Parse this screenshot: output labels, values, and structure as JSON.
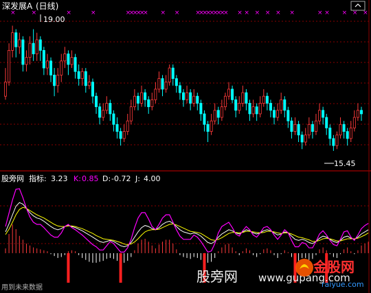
{
  "header": {
    "stock_title": "深发展A",
    "period": "(日线)"
  },
  "indicator_header": {
    "site": "股旁网",
    "label": "指标:",
    "value": "3.23",
    "k_label": "K:",
    "k_value": "0.85",
    "d_label": "D:",
    "d_value": "-0.72",
    "j_label": "J:",
    "j_value": "4.00"
  },
  "watermarks": {
    "site_cn": "股旁网",
    "site_url": "www.gupang.com",
    "bottom_note": "用到未来数据",
    "logo_text": "金股网",
    "logo_url": "raiyue.com"
  },
  "colors": {
    "background": "#000000",
    "up_candle": "#ff3b3b",
    "down_candle": "#00ffff",
    "grid": "#8b0000",
    "kdj_k": "#ffffff",
    "kdj_d": "#ffff00",
    "kdj_j": "#ff00ff",
    "signal": "#ff00ff",
    "title": "#ffffff"
  },
  "chart_data": [
    {
      "type": "candlestick",
      "title": "深发展A (日线)",
      "ylim": [
        15.0,
        19.3
      ],
      "annotations": [
        {
          "text": "19.00",
          "kind": "high"
        },
        {
          "text": "15.45",
          "kind": "low"
        }
      ],
      "signals": [
        2,
        8,
        18,
        25,
        35,
        36,
        37,
        38,
        39,
        40,
        45,
        49,
        55,
        56,
        57,
        58,
        59,
        60,
        61,
        62,
        63,
        67,
        69,
        72,
        75,
        78,
        82,
        90,
        92,
        97,
        100,
        103
      ],
      "candles": [
        [
          17.0,
          17.4,
          17.8,
          16.9
        ],
        [
          17.4,
          18.3,
          18.5,
          17.3
        ],
        [
          18.3,
          18.8,
          19.0,
          18.1
        ],
        [
          18.8,
          18.4,
          18.9,
          18.1
        ],
        [
          18.4,
          18.6,
          18.8,
          18.2
        ],
        [
          18.6,
          17.9,
          18.7,
          17.7
        ],
        [
          17.9,
          18.1,
          18.3,
          17.7
        ],
        [
          18.1,
          18.5,
          18.7,
          17.9
        ],
        [
          18.5,
          18.2,
          18.9,
          18.0
        ],
        [
          18.2,
          18.6,
          18.8,
          18.0
        ],
        [
          18.6,
          18.3,
          18.7,
          18.0
        ],
        [
          18.3,
          17.8,
          18.4,
          17.6
        ],
        [
          17.8,
          18.0,
          18.2,
          17.6
        ],
        [
          18.0,
          17.6,
          18.1,
          17.4
        ],
        [
          17.6,
          17.3,
          17.8,
          17.0
        ],
        [
          17.3,
          17.6,
          17.8,
          17.1
        ],
        [
          17.6,
          18.0,
          18.2,
          17.4
        ],
        [
          18.0,
          18.2,
          18.4,
          17.8
        ],
        [
          18.2,
          17.9,
          18.3,
          17.6
        ],
        [
          17.9,
          18.1,
          18.3,
          17.8
        ],
        [
          18.1,
          17.7,
          18.2,
          17.5
        ],
        [
          17.7,
          17.5,
          17.9,
          17.3
        ],
        [
          17.5,
          17.7,
          17.8,
          17.3
        ],
        [
          17.7,
          17.3,
          17.8,
          17.1
        ],
        [
          17.3,
          17.4,
          17.6,
          17.2
        ],
        [
          17.4,
          17.0,
          17.5,
          16.8
        ],
        [
          17.0,
          16.7,
          17.1,
          16.5
        ],
        [
          16.7,
          16.4,
          16.8,
          16.2
        ],
        [
          16.4,
          16.6,
          16.8,
          16.3
        ],
        [
          16.6,
          16.8,
          17.0,
          16.5
        ],
        [
          16.8,
          16.5,
          16.9,
          16.3
        ],
        [
          16.5,
          16.2,
          16.6,
          16.0
        ],
        [
          16.2,
          16.0,
          16.4,
          15.8
        ],
        [
          16.0,
          15.8,
          16.1,
          15.6
        ],
        [
          15.8,
          16.0,
          16.2,
          15.7
        ],
        [
          16.0,
          16.3,
          16.5,
          15.9
        ],
        [
          16.3,
          16.7,
          16.9,
          16.2
        ],
        [
          16.7,
          17.0,
          17.2,
          16.6
        ],
        [
          17.0,
          16.8,
          17.1,
          16.6
        ],
        [
          16.8,
          17.1,
          17.3,
          16.7
        ],
        [
          17.1,
          16.9,
          17.2,
          16.7
        ],
        [
          16.9,
          16.7,
          17.0,
          16.5
        ],
        [
          16.7,
          16.9,
          17.1,
          16.6
        ],
        [
          16.9,
          17.2,
          17.4,
          16.8
        ],
        [
          17.2,
          17.5,
          17.7,
          17.1
        ],
        [
          17.5,
          17.2,
          17.6,
          17.0
        ],
        [
          17.2,
          17.4,
          17.6,
          17.1
        ],
        [
          17.4,
          17.8,
          17.9,
          17.3
        ],
        [
          17.8,
          17.5,
          17.9,
          17.3
        ],
        [
          17.5,
          17.3,
          17.6,
          17.1
        ],
        [
          17.3,
          17.1,
          17.4,
          16.9
        ],
        [
          17.1,
          16.9,
          17.2,
          16.7
        ],
        [
          16.9,
          17.1,
          17.3,
          16.8
        ],
        [
          17.1,
          16.8,
          17.2,
          16.6
        ],
        [
          16.8,
          17.0,
          17.2,
          16.7
        ],
        [
          17.0,
          16.8,
          17.1,
          16.6
        ],
        [
          16.8,
          16.5,
          16.9,
          16.3
        ],
        [
          16.5,
          16.2,
          16.6,
          16.0
        ],
        [
          16.2,
          16.0,
          16.3,
          15.7
        ],
        [
          16.0,
          16.3,
          16.5,
          15.9
        ],
        [
          16.3,
          16.6,
          16.8,
          16.2
        ],
        [
          16.6,
          16.4,
          16.7,
          16.2
        ],
        [
          16.4,
          16.7,
          16.9,
          16.3
        ],
        [
          16.7,
          17.0,
          17.1,
          16.6
        ],
        [
          17.0,
          17.2,
          17.4,
          16.9
        ],
        [
          17.2,
          16.9,
          17.3,
          16.8
        ],
        [
          16.9,
          16.6,
          17.0,
          16.4
        ],
        [
          16.6,
          16.8,
          17.0,
          16.5
        ],
        [
          16.8,
          17.1,
          17.3,
          16.7
        ],
        [
          17.1,
          16.8,
          17.2,
          16.6
        ],
        [
          16.8,
          16.5,
          16.9,
          16.3
        ],
        [
          16.5,
          16.7,
          16.9,
          16.4
        ],
        [
          16.7,
          16.5,
          16.8,
          16.3
        ],
        [
          16.5,
          16.8,
          17.0,
          16.4
        ],
        [
          16.8,
          17.0,
          17.2,
          16.7
        ],
        [
          17.0,
          16.8,
          17.1,
          16.6
        ],
        [
          16.8,
          16.6,
          16.9,
          16.4
        ],
        [
          16.6,
          16.4,
          16.7,
          16.2
        ],
        [
          16.4,
          16.6,
          16.8,
          16.3
        ],
        [
          16.6,
          16.9,
          17.1,
          16.5
        ],
        [
          16.9,
          16.6,
          17.0,
          16.4
        ],
        [
          16.6,
          16.3,
          16.7,
          16.1
        ],
        [
          16.3,
          16.0,
          16.4,
          15.8
        ],
        [
          16.0,
          16.2,
          16.4,
          15.9
        ],
        [
          16.2,
          15.9,
          16.3,
          15.7
        ],
        [
          15.9,
          15.7,
          16.0,
          15.5
        ],
        [
          15.7,
          15.9,
          16.1,
          15.6
        ],
        [
          15.9,
          16.2,
          16.4,
          15.8
        ],
        [
          16.2,
          16.0,
          16.3,
          15.8
        ],
        [
          16.0,
          16.3,
          16.5,
          15.9
        ],
        [
          16.3,
          16.6,
          16.8,
          16.2
        ],
        [
          16.6,
          16.4,
          16.7,
          16.2
        ],
        [
          16.4,
          16.1,
          16.5,
          15.9
        ],
        [
          16.1,
          15.8,
          16.2,
          15.6
        ],
        [
          15.8,
          15.6,
          15.9,
          15.45
        ],
        [
          15.6,
          15.9,
          16.0,
          15.5
        ],
        [
          15.9,
          16.2,
          16.4,
          15.8
        ],
        [
          16.2,
          16.0,
          16.3,
          15.8
        ],
        [
          16.0,
          15.8,
          16.1,
          15.6
        ],
        [
          15.8,
          16.1,
          16.3,
          15.7
        ],
        [
          16.1,
          16.4,
          16.6,
          16.0
        ],
        [
          16.4,
          16.6,
          16.8,
          16.3
        ],
        [
          16.6,
          16.5,
          16.7,
          16.3
        ]
      ]
    },
    {
      "type": "line",
      "title": "",
      "ylim": [
        -40,
        130
      ],
      "series": [
        {
          "name": "K",
          "values": [
            40,
            55,
            72,
            88,
            95,
            92,
            84,
            76,
            70,
            66,
            64,
            60,
            55,
            50,
            46,
            44,
            46,
            50,
            52,
            50,
            48,
            45,
            42,
            38,
            34,
            30,
            26,
            22,
            20,
            22,
            24,
            22,
            18,
            14,
            12,
            14,
            20,
            30,
            40,
            48,
            52,
            50,
            46,
            44,
            48,
            54,
            58,
            60,
            56,
            50,
            44,
            40,
            38,
            36,
            38,
            36,
            32,
            26,
            20,
            18,
            22,
            30,
            36,
            40,
            44,
            42,
            38,
            36,
            40,
            44,
            42,
            38,
            36,
            38,
            42,
            44,
            42,
            38,
            34,
            36,
            40,
            38,
            32,
            26,
            24,
            26,
            24,
            20,
            18,
            22,
            28,
            32,
            30,
            26,
            22,
            20,
            24,
            30,
            32,
            28,
            26,
            30,
            36,
            40,
            44
          ]
        },
        {
          "name": "D",
          "values": [
            35,
            45,
            58,
            72,
            82,
            86,
            84,
            80,
            76,
            72,
            69,
            66,
            62,
            58,
            54,
            51,
            50,
            50,
            51,
            51,
            50,
            48,
            46,
            43,
            40,
            37,
            33,
            30,
            27,
            26,
            25,
            24,
            22,
            20,
            17,
            16,
            17,
            21,
            27,
            34,
            40,
            43,
            44,
            44,
            45,
            48,
            51,
            54,
            55,
            53,
            50,
            47,
            44,
            41,
            40,
            39,
            37,
            33,
            29,
            25,
            24,
            26,
            29,
            33,
            37,
            39,
            39,
            38,
            39,
            41,
            41,
            40,
            39,
            38,
            39,
            41,
            41,
            40,
            38,
            37,
            38,
            38,
            36,
            33,
            30,
            29,
            27,
            25,
            22,
            22,
            24,
            27,
            28,
            27,
            25,
            23,
            23,
            25,
            27,
            27,
            27,
            28,
            31,
            34,
            38
          ]
        },
        {
          "name": "J",
          "values": [
            50,
            75,
            100,
            120,
            121,
            104,
            84,
            68,
            58,
            54,
            54,
            48,
            41,
            34,
            30,
            30,
            38,
            50,
            54,
            48,
            44,
            39,
            34,
            28,
            22,
            16,
            12,
            6,
            6,
            14,
            22,
            18,
            10,
            2,
            2,
            10,
            26,
            48,
            66,
            76,
            76,
            64,
            50,
            44,
            54,
            66,
            72,
            72,
            58,
            44,
            32,
            26,
            26,
            26,
            34,
            30,
            22,
            12,
            2,
            4,
            18,
            38,
            50,
            54,
            58,
            48,
            36,
            32,
            42,
            50,
            44,
            34,
            30,
            38,
            48,
            50,
            44,
            34,
            26,
            34,
            44,
            38,
            24,
            12,
            12,
            20,
            18,
            10,
            10,
            22,
            36,
            42,
            34,
            24,
            16,
            14,
            26,
            40,
            42,
            30,
            24,
            34,
            46,
            52,
            56
          ]
        }
      ],
      "histogram": [
        5,
        20,
        30,
        25,
        18,
        14,
        10,
        8,
        6,
        5,
        4,
        3,
        2,
        -1,
        -3,
        -5,
        -4,
        -2,
        2,
        3,
        2,
        -2,
        -5,
        -7,
        -9,
        -10,
        -10,
        -9,
        -8,
        -6,
        -5,
        -6,
        -8,
        -9,
        -10,
        -8,
        -4,
        3,
        10,
        14,
        15,
        12,
        8,
        5,
        9,
        12,
        14,
        14,
        10,
        4,
        -2,
        -4,
        -5,
        -6,
        -4,
        -5,
        -7,
        -9,
        -10,
        -9,
        -5,
        2,
        6,
        9,
        10,
        6,
        2,
        -2,
        2,
        5,
        3,
        -2,
        -4,
        -1,
        4,
        5,
        3,
        -2,
        -5,
        -1,
        3,
        1,
        -4,
        -8,
        -8,
        -5,
        -5,
        -7,
        -6,
        -2,
        4,
        6,
        3,
        -1,
        -4,
        -5,
        -1,
        4,
        6,
        2,
        -1,
        3,
        8,
        10,
        12
      ],
      "signal_bars": [
        18,
        33,
        57,
        83,
        92
      ]
    }
  ]
}
